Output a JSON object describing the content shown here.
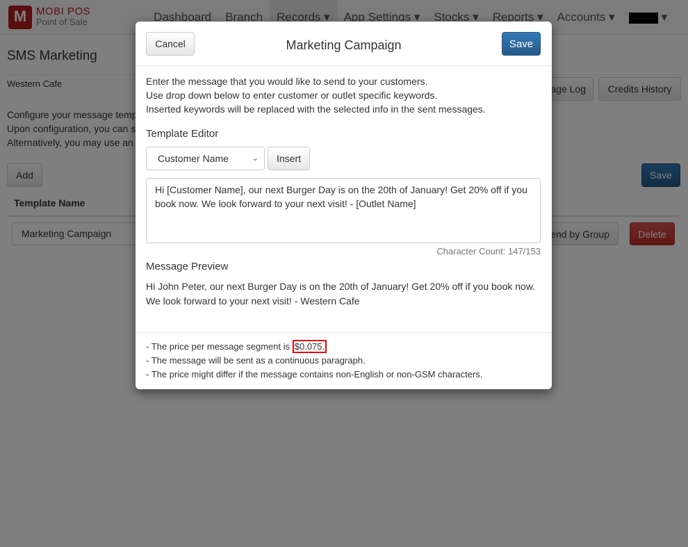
{
  "brand": {
    "logo_letter": "M",
    "name": "MOBI POS",
    "tagline": "Point of Sale"
  },
  "nav": {
    "items": [
      "Dashboard",
      "Branch",
      "Records",
      "App Settings",
      "Stocks",
      "Reports",
      "Accounts"
    ],
    "caret": "▾"
  },
  "page": {
    "title": "SMS Marketing",
    "outlet": "Western Cafe",
    "desc": [
      "Configure your message temp",
      "Upon configuration, you can s",
      "Alternatively, you may use an"
    ],
    "message_log": "age Log",
    "credits_history": "Credits History",
    "add": "Add",
    "save": "Save",
    "col_template_name": "Template Name",
    "row_template": "Marketing Campaign",
    "send_by_group": "end by Group",
    "delete": "Delete"
  },
  "modal": {
    "cancel": "Cancel",
    "title": "Marketing Campaign",
    "save": "Save",
    "intro": [
      "Enter the message that you would like to send to your customers.",
      "Use drop down below to enter customer or outlet specific keywords.",
      "Inserted keywords will be replaced with the selected info in the sent messages."
    ],
    "editor_label": "Template Editor",
    "keyword_selected": "Customer Name",
    "insert": "Insert",
    "template_text": "Hi [Customer Name], our next Burger Day is on the 20th of January! Get 20% off if you book now. We look forward to your next visit! - [Outlet Name]",
    "char_count": "Character Count: 147/153",
    "preview_label": "Message Preview",
    "preview_text": "Hi John Peter, our next Burger Day is on the 20th of January! Get 20% off if you book now. We look forward to your next visit! - Western Cafe",
    "footer_prefix": "- The price per message segment is ",
    "price": "$0.075.",
    "footer": [
      "- The message will be sent as a continuous paragraph.",
      "- The price might differ if the message contains non-English or non-GSM characters."
    ]
  }
}
